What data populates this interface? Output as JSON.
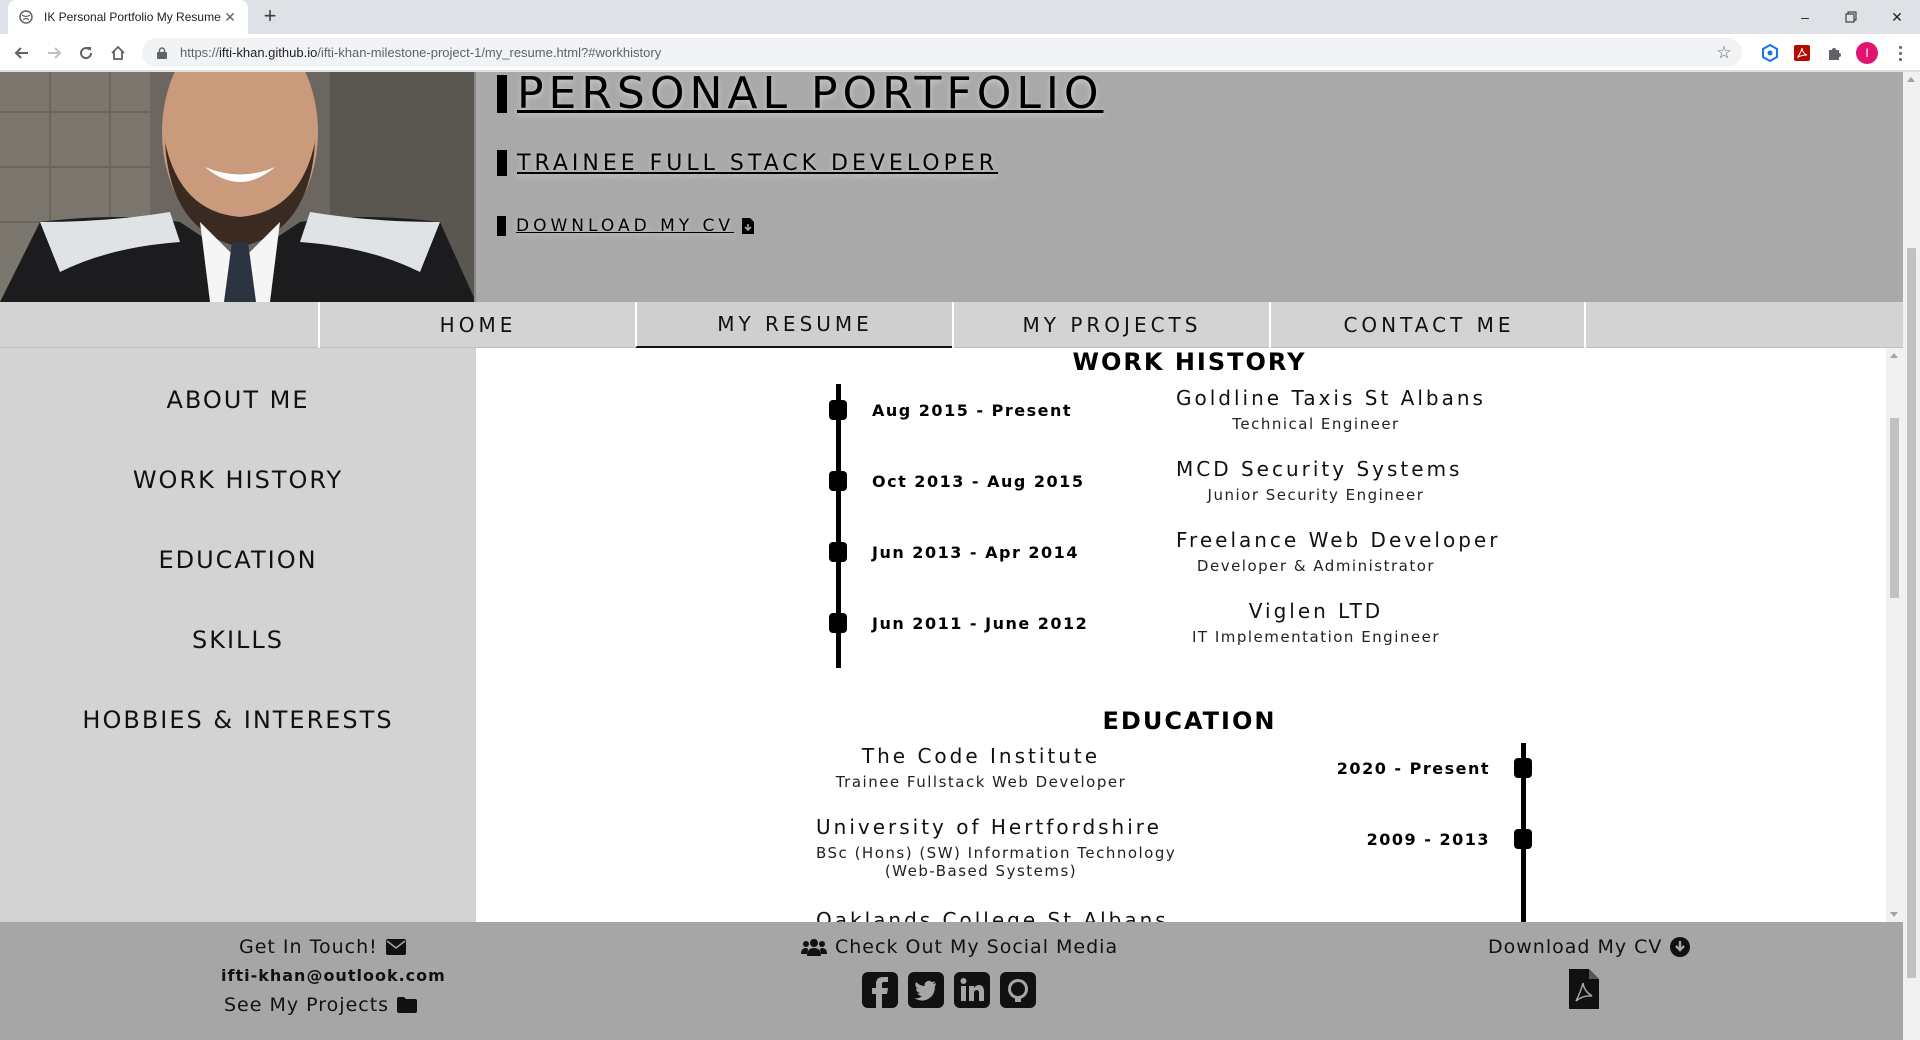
{
  "browser": {
    "tab_title": "IK Personal Portfolio My Resume",
    "url_prefix": "https://",
    "url_host": "ifti-khan.github.io",
    "url_path": "/ifti-khan-milestone-project-1/my_resume.html?#workhistory",
    "profile_initial": "I"
  },
  "hero": {
    "title": "PERSONAL PORTFOLIO",
    "subtitle": "TRAINEE FULL STACK DEVELOPER",
    "cv_link": "DOWNLOAD MY CV"
  },
  "nav": {
    "items": [
      {
        "label": "HOME"
      },
      {
        "label": "MY RESUME"
      },
      {
        "label": "MY PROJECTS"
      },
      {
        "label": "CONTACT ME"
      }
    ]
  },
  "sidebar": {
    "items": [
      {
        "label": "ABOUT ME"
      },
      {
        "label": "WORK HISTORY"
      },
      {
        "label": "EDUCATION"
      },
      {
        "label": "SKILLS"
      },
      {
        "label": "HOBBIES & INTERESTS"
      }
    ]
  },
  "work_history": {
    "title": "WORK HISTORY",
    "entries": [
      {
        "date": "Aug 2015 - Present",
        "org": "Goldline Taxis St Albans",
        "role": "Technical Engineer"
      },
      {
        "date": "Oct 2013 - Aug 2015",
        "org": "MCD Security Systems",
        "role": "Junior Security Engineer"
      },
      {
        "date": "Jun 2013 - Apr 2014",
        "org": "Freelance Web Developer",
        "role": "Developer & Administrator"
      },
      {
        "date": "Jun 2011 - June 2012",
        "org": "Viglen LTD",
        "role": "IT Implementation Engineer"
      }
    ]
  },
  "education": {
    "title": "EDUCATION",
    "entries": [
      {
        "date": "2020 - Present",
        "org": "The Code Institute",
        "role": "Trainee Fullstack Web Developer"
      },
      {
        "date": "2009 - 2013",
        "org": "University of Hertfordshire",
        "role": "BSc (Hons) (SW) Information Technology",
        "role2": "(Web-Based Systems)"
      },
      {
        "org": "Oaklands College St Albans"
      }
    ]
  },
  "footer": {
    "contact_label": "Get In Touch!",
    "email": "ifti-khan@outlook.com",
    "projects_label": "See My Projects",
    "social_label": "Check Out My Social Media",
    "cv_label": "Download My CV"
  },
  "icons": [
    "envelope-icon",
    "folder-icon",
    "users-icon",
    "facebook-icon",
    "twitter-icon",
    "linkedin-icon",
    "github-icon",
    "download-circle-icon",
    "pdf-file-icon",
    "file-download-icon"
  ]
}
